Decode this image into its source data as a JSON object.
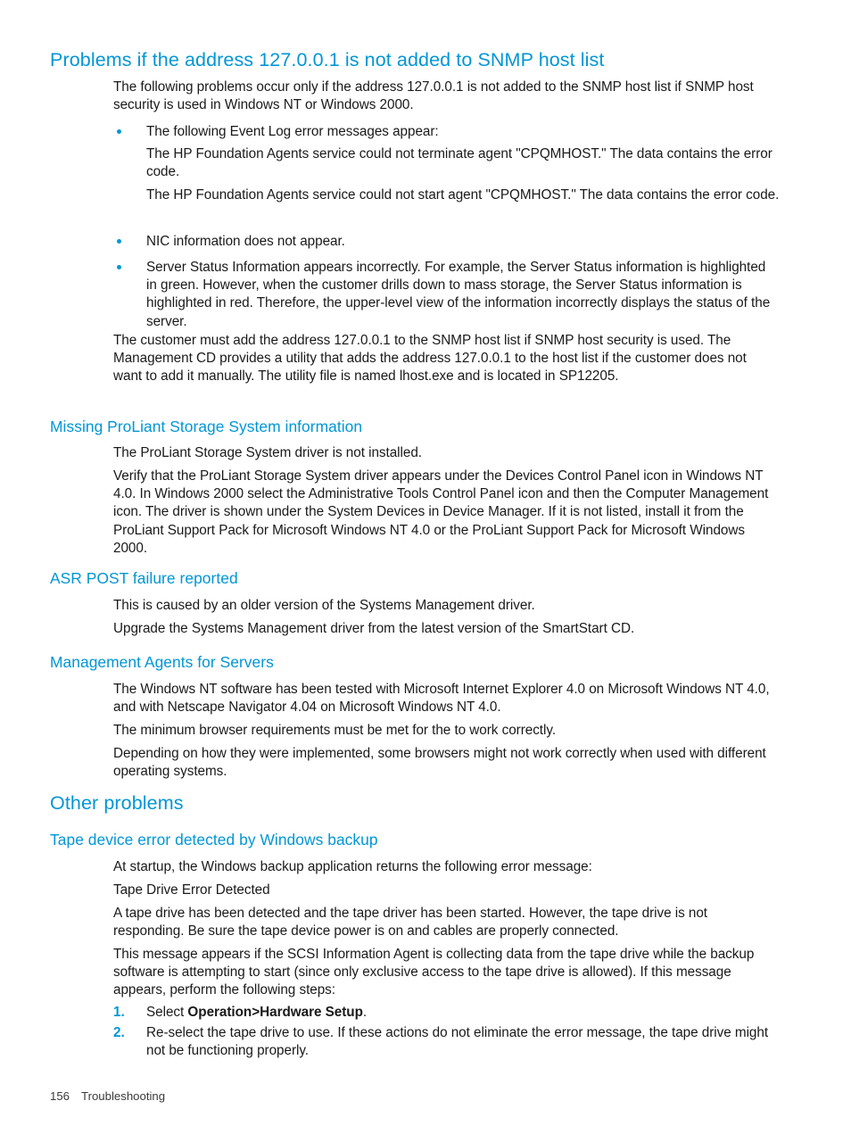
{
  "colors": {
    "heading_blue": "#0096d6",
    "body_text": "#1a1a1a",
    "footer_text": "#3a3a3a",
    "page_background": "#ffffff"
  },
  "sections": {
    "snmp": {
      "heading": "Problems if the address 127.0.0.1 is not added to SNMP host list",
      "intro": "The following problems occur only if the address 127.0.0.1 is not added to the SNMP host list if SNMP host security is used in Windows NT or Windows 2000.",
      "bullets": [
        "The following Event Log error messages appear:",
        "NIC information does not appear.",
        "Server Status Information appears incorrectly. For example, the Server Status information is highlighted in green. However, when the customer drills down to mass storage, the Server Status information is highlighted in red. Therefore, the upper-level view of the information incorrectly displays the status of the server."
      ],
      "event_log_messages": [
        "The HP Foundation Agents  service could not terminate agent \"CPQMHOST.\" The data contains the error code.",
        "The HP Foundation Agents service could not start agent \"CPQMHOST.\" The data contains the error code."
      ],
      "closing": "The customer must add the address 127.0.0.1 to the SNMP host list if SNMP host security is used. The Management CD provides a utility that adds the address 127.0.0.1 to the host list if the customer does not want to add it manually. The utility file is named lhost.exe and is located in SP12205."
    },
    "storage": {
      "heading": "Missing ProLiant Storage System information",
      "paragraphs": [
        "The ProLiant Storage System driver is not installed.",
        "Verify that the ProLiant Storage System driver appears under the Devices Control Panel icon in Windows NT 4.0. In Windows 2000 select the Administrative Tools Control Panel icon and then the Computer Management icon. The driver is shown under the System Devices in Device Manager. If it is not listed, install it from the ProLiant Support Pack for Microsoft Windows NT 4.0 or the ProLiant Support Pack for Microsoft Windows 2000."
      ]
    },
    "asr": {
      "heading": "ASR POST failure reported",
      "paragraphs": [
        "This is caused by an older version of the Systems Management driver.",
        "Upgrade the Systems Management driver from the latest version of the SmartStart CD."
      ]
    },
    "agents": {
      "heading": "Management Agents for Servers",
      "paragraphs": [
        "The Windows NT software has been tested with Microsoft Internet Explorer 4.0 on Microsoft Windows NT 4.0, and with Netscape Navigator 4.04 on Microsoft Windows NT 4.0.",
        "The minimum browser requirements must be met for the to work correctly.",
        "Depending on how they were implemented, some browsers might not work correctly when used with different operating systems."
      ]
    },
    "other_problems": {
      "heading": "Other problems"
    },
    "tape": {
      "heading": "Tape device error detected by Windows backup",
      "paragraphs": [
        "At startup, the Windows backup application returns the following error message:",
        "Tape Drive Error Detected",
        "A tape drive has been detected and the tape driver has been started. However, the tape drive is not responding. Be sure the tape device power is on and cables are properly connected.",
        "This message appears if the SCSI Information Agent is collecting data from the tape drive while the backup software is attempting to start (since only exclusive access to the tape drive is allowed). If this message appears, perform the following steps:"
      ],
      "steps": [
        {
          "number": "1.",
          "prefix": "Select ",
          "bold1": "Operation",
          "separator": ">",
          "bold2": "Hardware Setup",
          "suffix": "."
        },
        {
          "number": "2.",
          "text": "Re-select the tape drive to use. If these actions do not eliminate the error message, the tape drive might not be functioning properly."
        }
      ]
    }
  },
  "footer": {
    "page_number": "156",
    "chapter": "Troubleshooting"
  }
}
